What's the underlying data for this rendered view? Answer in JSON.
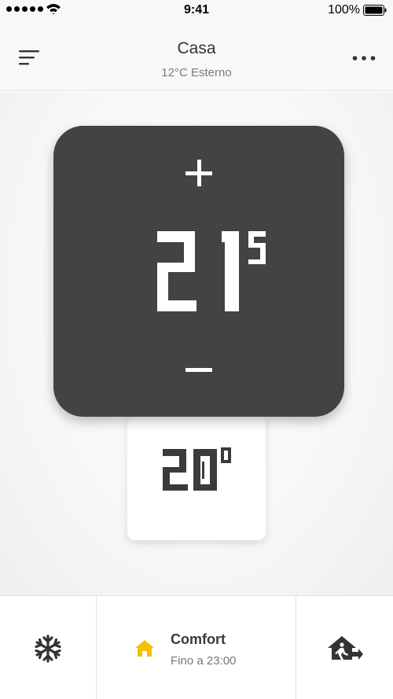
{
  "status_bar": {
    "time": "9:41",
    "battery_percent": "100%",
    "signal_bars": 5,
    "icons": [
      "signal-dots-icon",
      "wifi-icon",
      "battery-icon"
    ]
  },
  "header": {
    "title": "Casa",
    "subtitle": "12°C Esterno",
    "icons": [
      "menu-icon",
      "more-icon"
    ]
  },
  "thermostat": {
    "target_temperature": "21",
    "target_decimal": "5",
    "current_temperature": "20",
    "current_unit": "°",
    "head_color": "#434343",
    "icons": [
      "plus-icon",
      "minus-icon"
    ]
  },
  "bottom_bar": {
    "mode_label": "Comfort",
    "mode_until": "Fino a 23:00",
    "accent_color": "#f5c000",
    "icons": [
      "snowflake-icon",
      "home-icon",
      "away-icon"
    ]
  }
}
